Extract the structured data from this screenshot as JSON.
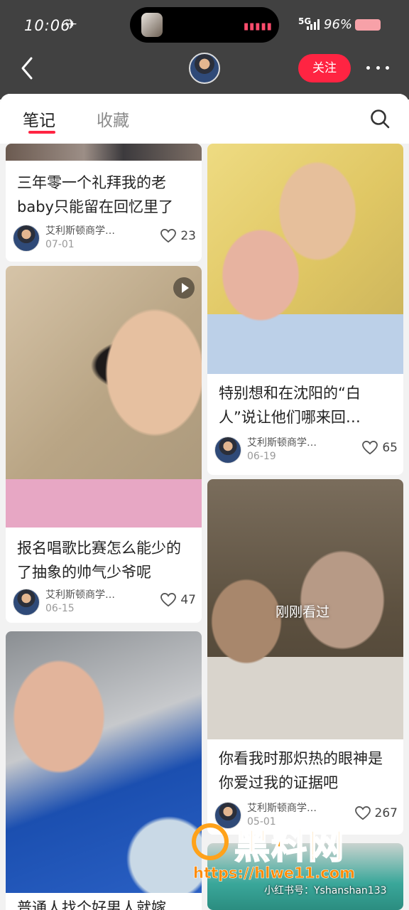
{
  "status": {
    "time": "10:06",
    "network": "5G",
    "battery": "96%"
  },
  "header": {
    "follow_label": "关注"
  },
  "tabs": [
    {
      "label": "笔记"
    },
    {
      "label": "收藏"
    }
  ],
  "cards": [
    {
      "title": "三年零一个礼拜我的老baby只能留在回忆里了",
      "author": "艾利斯顿商学…",
      "date": "07-01",
      "likes": "23"
    },
    {
      "title": "报名唱歌比赛怎么能少的了抽象的帅气少爷呢",
      "author": "艾利斯顿商学…",
      "date": "06-15",
      "likes": "47"
    },
    {
      "title": "普通人找个好男人就嫁"
    },
    {
      "title": "特别想和在沈阳的“白人”说让他们哪来回…",
      "author": "艾利斯顿商学…",
      "date": "06-19",
      "likes": "65"
    },
    {
      "title": "你看我时那炽热的眼神是你爱过我的证据吧",
      "author": "艾利斯顿商学…",
      "date": "05-01",
      "likes": "267",
      "overlay": "刚刚看过"
    }
  ],
  "watermark": {
    "main": "黑料网",
    "url": "https://hlwe11.com",
    "redbook": "小红书号：Yshanshan133"
  },
  "colors": {
    "accent": "#ff2442",
    "header_bg": "#414141"
  },
  "icons": [
    "back-icon",
    "more-icon",
    "search-icon",
    "heart-icon",
    "play-icon"
  ]
}
